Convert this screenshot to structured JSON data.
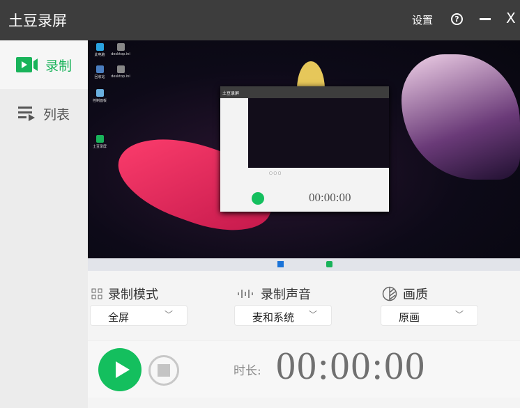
{
  "titlebar": {
    "title": "土豆录屏",
    "settings": "设置",
    "help_icon": "?",
    "minimize": "—",
    "close": "X"
  },
  "sidebar": {
    "items": [
      {
        "label": "录制",
        "icon": "video-camera-icon",
        "active": true
      },
      {
        "label": "列表",
        "icon": "list-play-icon",
        "active": false
      }
    ]
  },
  "preview": {
    "desktop_icons": [
      "此电脑",
      "desktop.ini",
      "回收站",
      "desktop.ini",
      "控制面板",
      "土豆录屏"
    ],
    "mini_title": "土豆录屏",
    "mini_timer": "00:00:00"
  },
  "controls": {
    "mode": {
      "label": "录制模式",
      "value": "全屏",
      "icon": "grid-icon"
    },
    "audio": {
      "label": "录制声音",
      "value": "麦和系统",
      "icon": "sound-wave-icon"
    },
    "quality": {
      "label": "画质",
      "value": "原画",
      "icon": "quality-icon"
    },
    "duration_label": "时长:",
    "timer": "00:00:00"
  },
  "colors": {
    "accent": "#14bf5e",
    "titlebar": "#3d3d3d"
  }
}
